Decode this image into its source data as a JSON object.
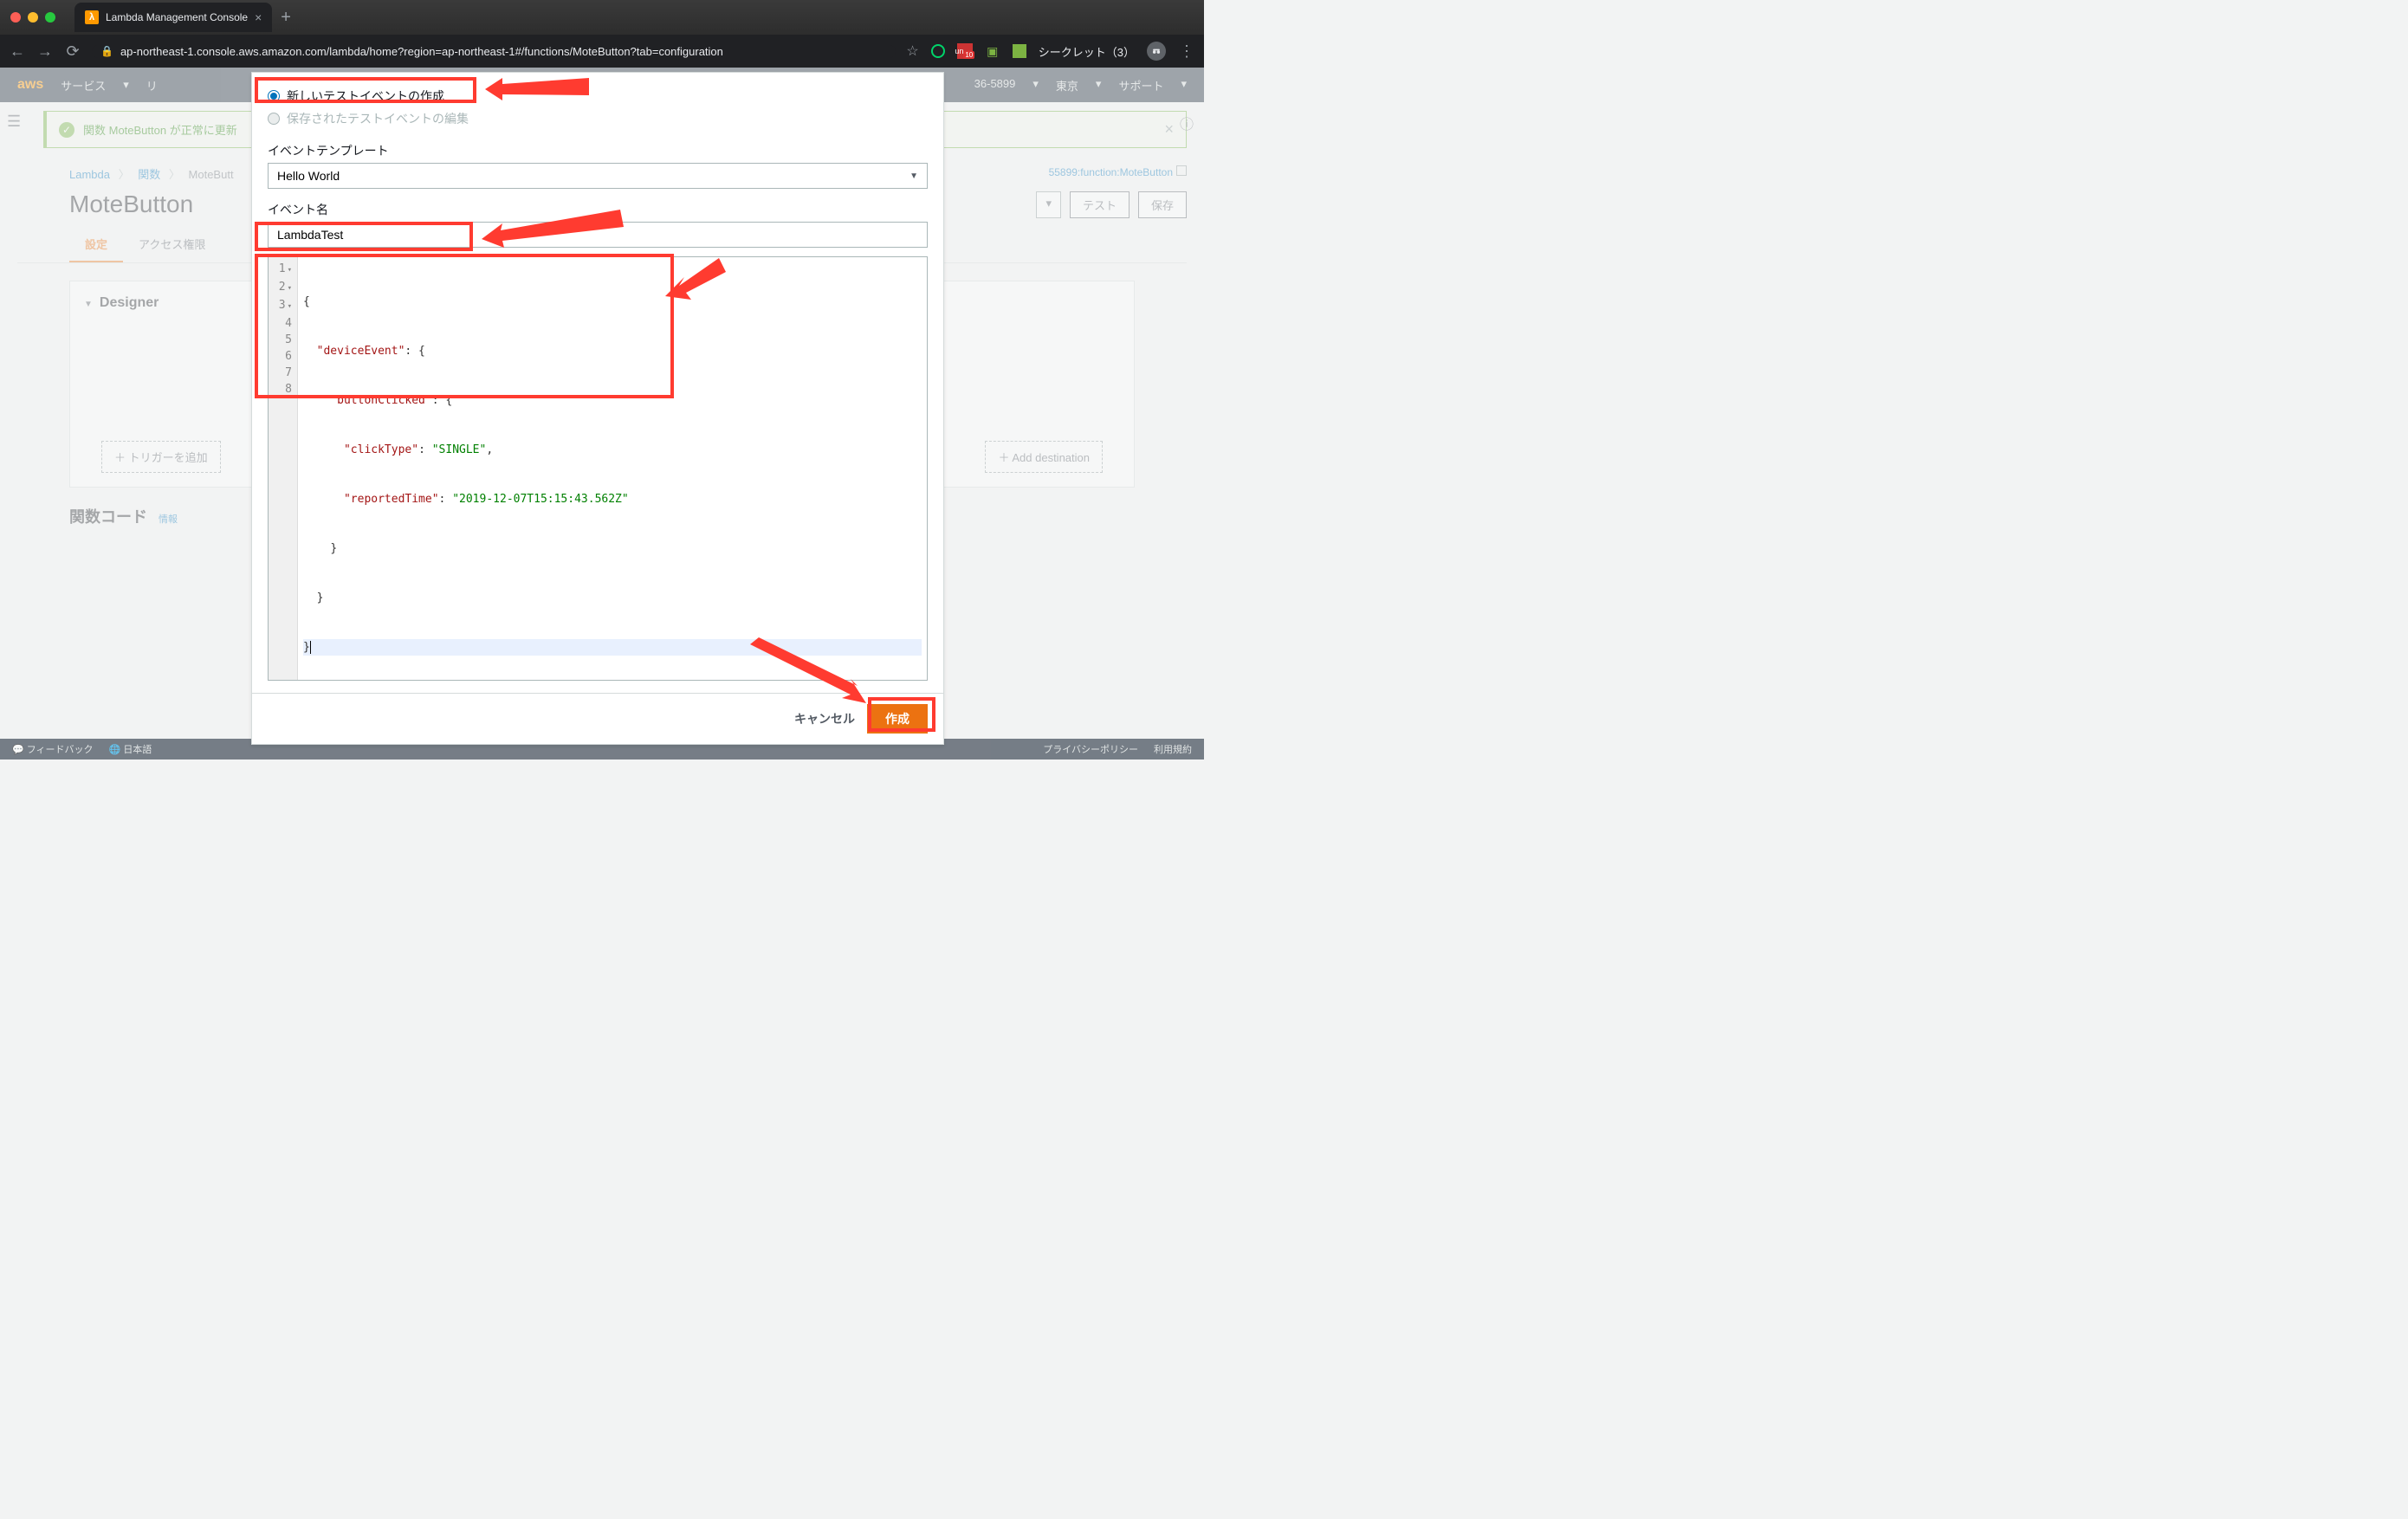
{
  "browser": {
    "tab_title": "Lambda Management Console",
    "url": "ap-northeast-1.console.aws.amazon.com/lambda/home?region=ap-northeast-1#/functions/MoteButton?tab=configuration",
    "incognito_label": "シークレット（3）",
    "ext_badge": "10"
  },
  "aws_nav": {
    "logo": "aws",
    "services": "サービス",
    "resources": "リ",
    "account": "36-5899",
    "region": "東京",
    "support": "サポート"
  },
  "banner": {
    "text": "関数 MoteButton が正常に更新"
  },
  "breadcrumb": {
    "root": "Lambda",
    "funcs": "関数",
    "current": "MoteButt",
    "arn_suffix": "55899:function:MoteButton"
  },
  "header": {
    "title": "MoteButton",
    "test_btn": "テスト",
    "save_btn": "保存"
  },
  "tabs": {
    "config": "設定",
    "permissions": "アクセス権限"
  },
  "designer": {
    "title": "Designer",
    "add_trigger": "＋ トリガーを追加",
    "add_destination": "＋ Add destination"
  },
  "code_section": {
    "title": "関数コード",
    "info": "情報"
  },
  "modal": {
    "radio_new": "新しいテストイベントの作成",
    "radio_saved": "保存されたテストイベントの編集",
    "template_label": "イベントテンプレート",
    "template_value": "Hello World",
    "name_label": "イベント名",
    "name_value": "LambdaTest",
    "cancel": "キャンセル",
    "create": "作成",
    "code": {
      "l1": "{",
      "l2_key": "\"deviceEvent\"",
      "l2_rest": ": {",
      "l3_key": "\"buttonClicked\"",
      "l3_rest": ": {",
      "l4_key": "\"clickType\"",
      "l4_val": "\"SINGLE\"",
      "l5_key": "\"reportedTime\"",
      "l5_val": "\"2019-12-07T15:15:43.562Z\"",
      "l6": "}",
      "l7": "}",
      "l8": "}"
    }
  },
  "footer": {
    "feedback": "フィードバック",
    "lang": "日本語",
    "privacy": "プライバシーポリシー",
    "terms": "利用規約"
  }
}
